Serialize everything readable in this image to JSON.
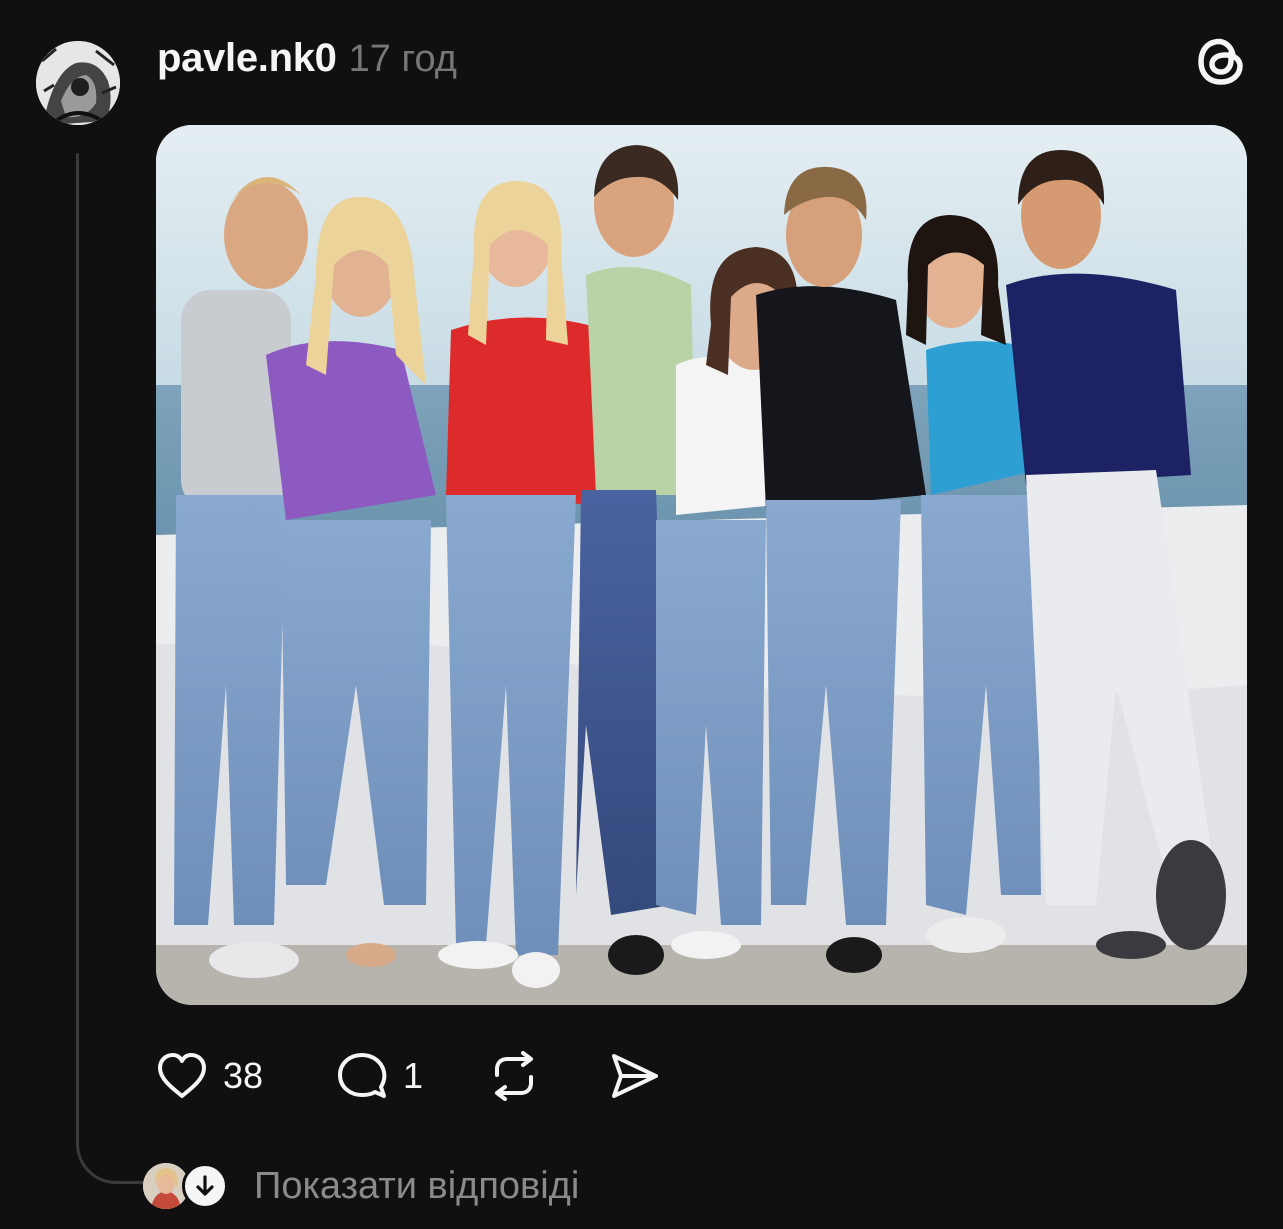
{
  "post": {
    "username": "pavle.nk0",
    "timestamp": "17 год",
    "avatar_icon": "user-avatar",
    "logo_icon": "threads-logo-icon",
    "image": {
      "subject": "group-photo",
      "people_count": 8
    },
    "actions": {
      "like": {
        "icon": "heart-icon",
        "count": "38"
      },
      "comment": {
        "icon": "comment-bubble-icon",
        "count": "1"
      },
      "repost": {
        "icon": "repost-icon"
      },
      "share": {
        "icon": "send-icon"
      }
    },
    "replies": {
      "label": "Показати відповіді",
      "icon": "arrow-down-icon"
    }
  },
  "colors": {
    "background": "#101010",
    "text_primary": "#f3f5f7",
    "text_secondary": "#777777",
    "thread_line": "#3a3a3a"
  }
}
